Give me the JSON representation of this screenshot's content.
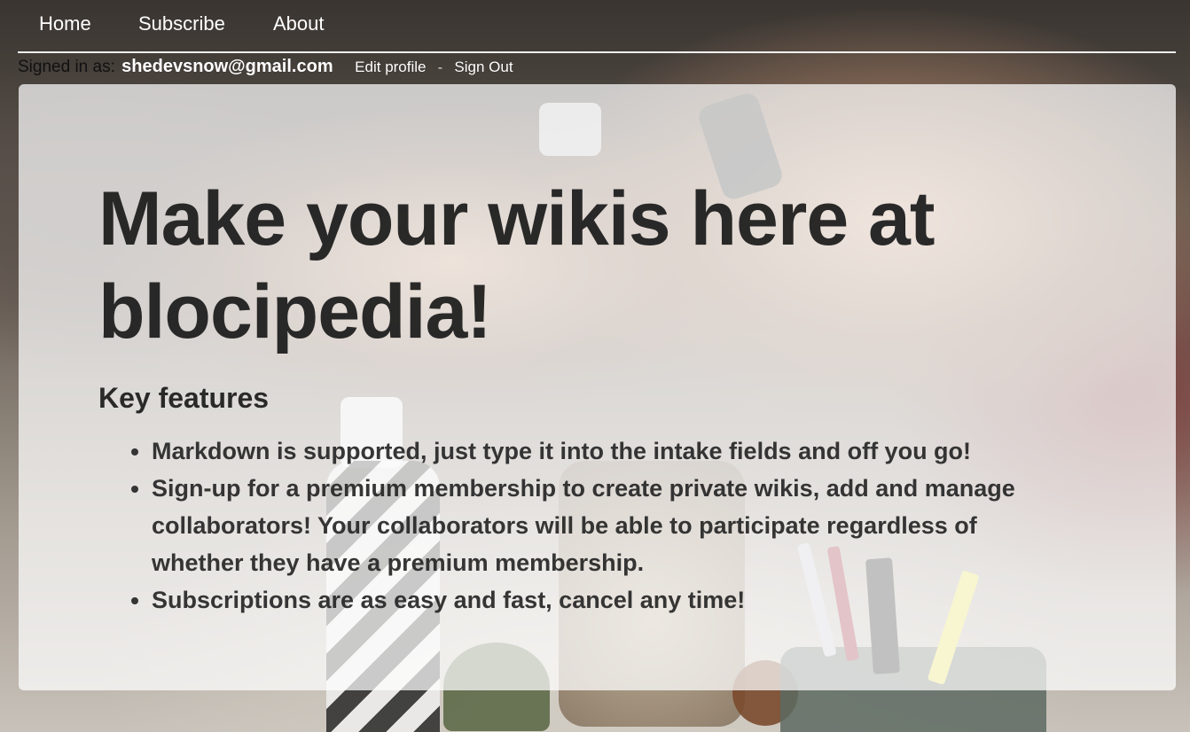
{
  "nav": {
    "items": [
      {
        "label": "Home"
      },
      {
        "label": "Subscribe"
      },
      {
        "label": "About"
      }
    ]
  },
  "session": {
    "signed_in_label": "Signed in as:",
    "email": "shedevsnow@gmail.com",
    "edit_profile_label": "Edit profile",
    "separator": "-",
    "sign_out_label": "Sign Out"
  },
  "hero": {
    "title": "Make your wikis here at blocipedia!"
  },
  "features": {
    "heading": "Key features",
    "items": [
      "Markdown is supported, just type it into the intake fields and off you go!",
      "Sign-up for a premium membership to create private wikis, add and manage collaborators! Your collaborators will be able to participate regardless of whether they have a premium membership.",
      "Subscriptions are as easy and fast, cancel any time!"
    ]
  },
  "colors": {
    "nav_text": "#ffffff",
    "nav_underline": "#f2f2f2",
    "overlay": "#ffffff",
    "heading_text": "#1a1a1a"
  },
  "background": {
    "description_icon": "team-fist-bump-photo"
  }
}
